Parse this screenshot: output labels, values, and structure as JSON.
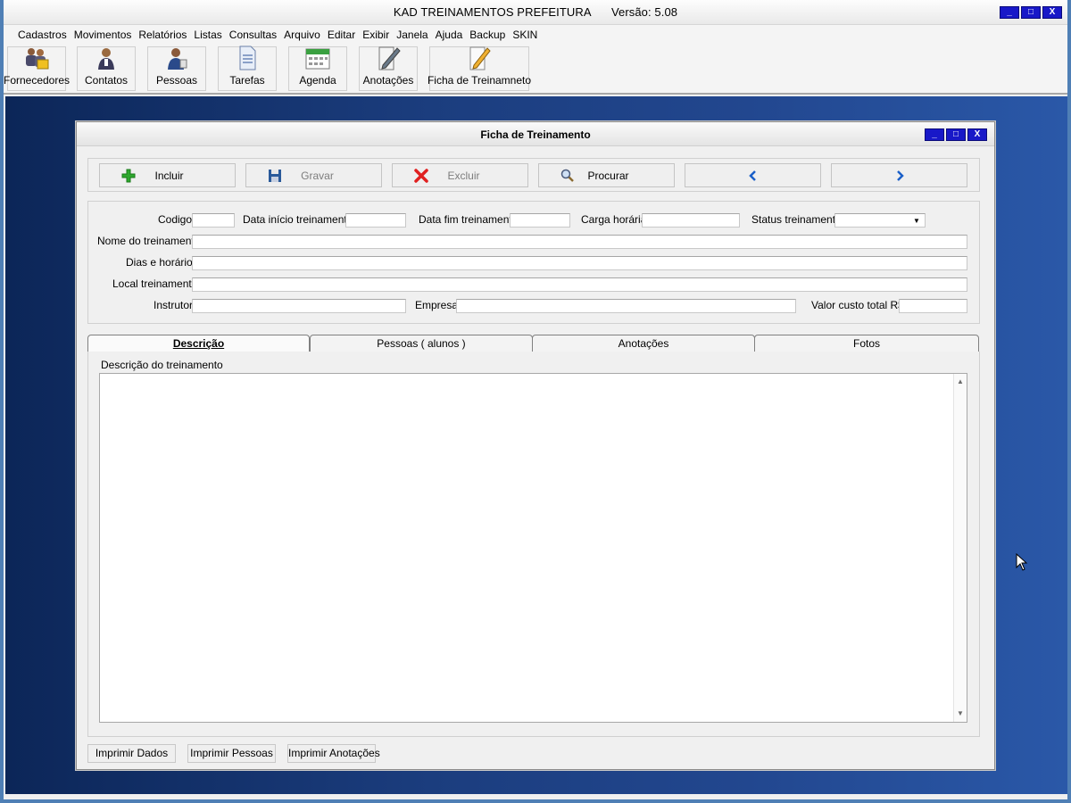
{
  "app": {
    "title": "KAD TREINAMENTOS PREFEITURA",
    "version": "Versão: 5.08"
  },
  "window_controls": {
    "minimize": "_",
    "maximize": "□",
    "close": "X"
  },
  "menu": [
    "Cadastros",
    "Movimentos",
    "Relatórios",
    "Listas",
    "Consultas",
    "Arquivo",
    "Editar",
    "Exibir",
    "Janela",
    "Ajuda",
    "Backup",
    "SKIN"
  ],
  "toolbar": [
    {
      "label": "Fornecedores",
      "icon": "suppliers-icon"
    },
    {
      "label": "Contatos",
      "icon": "contacts-icon"
    },
    {
      "label": "Pessoas",
      "icon": "people-icon"
    },
    {
      "label": "Tarefas",
      "icon": "tasks-icon"
    },
    {
      "label": "Agenda",
      "icon": "calendar-icon"
    },
    {
      "label": "Anotações",
      "icon": "notes-icon"
    },
    {
      "label": "Ficha de Treinamneto",
      "icon": "pencil-icon"
    }
  ],
  "form": {
    "title": "Ficha de Treinamento",
    "actions": {
      "include": "Incluir",
      "save": "Gravar",
      "delete": "Excluir",
      "search": "Procurar"
    },
    "fields": {
      "codigo": {
        "label": "Codigo",
        "value": ""
      },
      "data_inicio": {
        "label": "Data início treinamento",
        "value": ""
      },
      "data_fim": {
        "label": "Data fim treinamento",
        "value": ""
      },
      "carga_horaria": {
        "label": "Carga horária",
        "value": ""
      },
      "status": {
        "label": "Status treinamento",
        "value": ""
      },
      "nome": {
        "label": "Nome do treinamento",
        "value": ""
      },
      "dias_horarios": {
        "label": "Dias e horários",
        "value": ""
      },
      "local": {
        "label": "Local treinamento",
        "value": ""
      },
      "instrutor": {
        "label": "Instrutor",
        "value": ""
      },
      "empresa": {
        "label": "Empresa",
        "value": ""
      },
      "valor_custo": {
        "label": "Valor custo total R$",
        "value": ""
      }
    },
    "tabs": [
      "Descrição",
      "Pessoas ( alunos )",
      "Anotações",
      "Fotos"
    ],
    "active_tab": "Descrição",
    "description_label": "Descrição do treinamento",
    "description_value": "",
    "print_buttons": {
      "data": "Imprimir Dados",
      "people": "Imprimir Pessoas",
      "notes": "Imprimir Anotações"
    }
  },
  "colors": {
    "window_button": "#1818c8",
    "desktop": "#1b3d7e",
    "add_icon": "#2ea82e",
    "delete_icon": "#e02020",
    "arrow_icon": "#1a5fc8"
  }
}
